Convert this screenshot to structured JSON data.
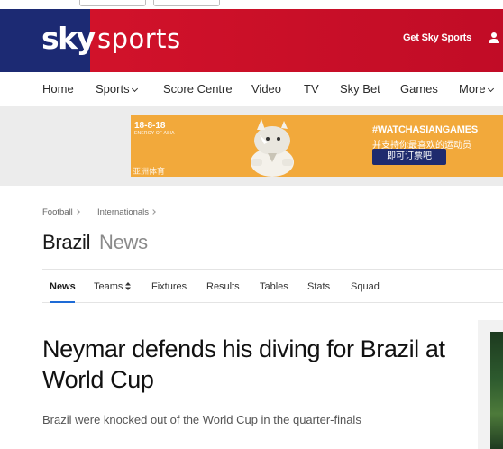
{
  "header": {
    "logo_sky": "sky",
    "logo_sports": "sports",
    "get_sky_sports": "Get Sky Sports",
    "user_icon": "user-icon",
    "colors": {
      "navy": "#1c2a73",
      "red": "#c10c26"
    }
  },
  "nav": {
    "items": [
      {
        "label": "Home"
      },
      {
        "label": "Sports",
        "dropdown": true
      },
      {
        "label": "Score Centre"
      },
      {
        "label": "Video"
      },
      {
        "label": "TV"
      },
      {
        "label": "Sky Bet"
      },
      {
        "label": "Games"
      },
      {
        "label": "More",
        "dropdown": true
      }
    ]
  },
  "ad": {
    "date": "18-8-18",
    "tagline": "ENERGY OF ASIA",
    "chinese_corner": "亚洲体育",
    "hashtag": "#WATCHASIANGAMES",
    "subtitle": "并支持你最喜欢的运动员",
    "cta": "即可订票吧",
    "background": "#f2a93b"
  },
  "breadcrumb": {
    "items": [
      "Football",
      "Internationals"
    ]
  },
  "page": {
    "title": "Brazil",
    "subtitle": "News"
  },
  "tabs": {
    "items": [
      {
        "label": "News",
        "active": true
      },
      {
        "label": "Teams",
        "sortable": true
      },
      {
        "label": "Fixtures"
      },
      {
        "label": "Results"
      },
      {
        "label": "Tables"
      },
      {
        "label": "Stats"
      },
      {
        "label": "Squad"
      }
    ],
    "accent": "#1e6bd6"
  },
  "article": {
    "headline": "Neymar defends his diving for Brazil at World Cup",
    "standfirst": "Brazil were knocked out of the World Cup in the quarter-finals"
  }
}
